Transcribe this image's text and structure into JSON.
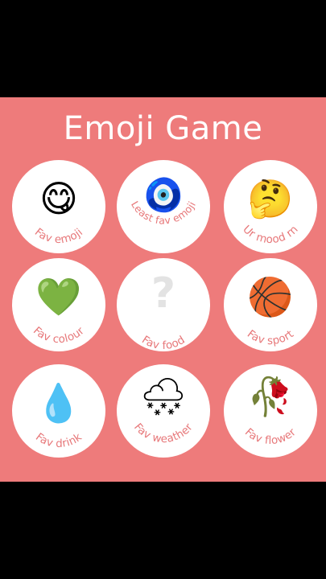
{
  "title": "Emoji Game",
  "colors": {
    "board": "#ee7b7b",
    "tile": "#ffffff",
    "caption": "#e7787a",
    "letterbox": "#000000"
  },
  "tiles": [
    {
      "label": "Fav emoji",
      "icon": "face-savoring-food-icon",
      "glyph": "😋"
    },
    {
      "label": "Least fav emoji",
      "icon": "nazar-amulet-icon",
      "glyph": "🧿"
    },
    {
      "label": "Ur mood rn",
      "icon": "thinking-face-icon",
      "glyph": "🤔"
    },
    {
      "label": "Fav colour",
      "icon": "green-heart-icon",
      "glyph": "💚"
    },
    {
      "label": "Fav food",
      "icon": "question-mark-icon",
      "glyph": "?"
    },
    {
      "label": "Fav sport",
      "icon": "basketball-icon",
      "glyph": "🏀"
    },
    {
      "label": "Fav drink",
      "icon": "droplet-icon",
      "glyph": "💧"
    },
    {
      "label": "Fav weather",
      "icon": "snow-cloud-icon",
      "glyph": "🌨"
    },
    {
      "label": "Fav flower",
      "icon": "wilted-flower-icon",
      "glyph": "🥀"
    }
  ]
}
